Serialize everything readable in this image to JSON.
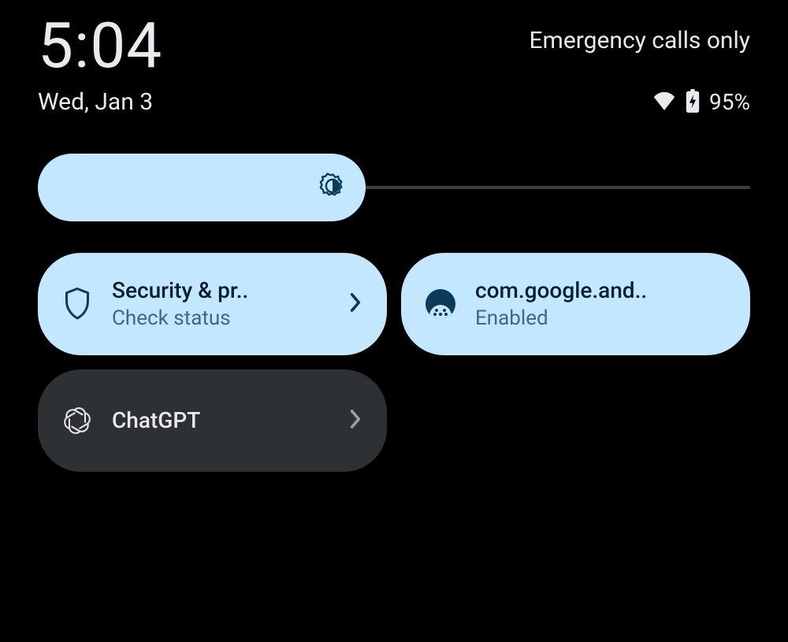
{
  "status": {
    "time": "5:04",
    "emergency": "Emergency calls only",
    "date": "Wed, Jan 3",
    "battery_pct": "95%"
  },
  "brightness": {
    "fill_pct": 46
  },
  "tiles": {
    "security": {
      "title": "Security & pr..",
      "subtitle": "Check status"
    },
    "google_and": {
      "title": "com.google.and..",
      "subtitle": "Enabled"
    },
    "chatgpt": {
      "title": "ChatGPT"
    }
  }
}
